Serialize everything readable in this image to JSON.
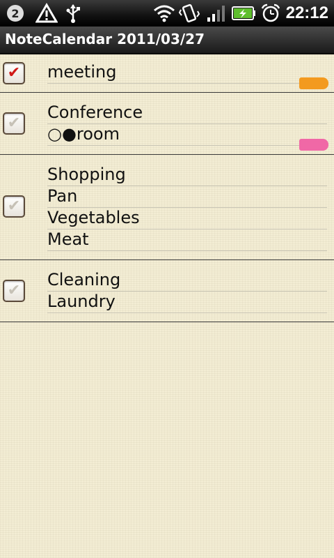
{
  "statusbar": {
    "time": "22:12",
    "icons": [
      "htc-sense-icon",
      "warning-icon",
      "usb-icon",
      "wifi-icon",
      "vibrate-icon",
      "signal-icon",
      "battery-charging-icon",
      "alarm-icon"
    ]
  },
  "title": "NoteCalendar 2011/03/27",
  "notes": [
    {
      "checked": true,
      "lines": [
        "meeting"
      ],
      "tag_color": "#f39a1f"
    },
    {
      "checked": false,
      "lines": [
        "Conference",
        "○●room"
      ],
      "tag_color": "#f068a6"
    },
    {
      "checked": false,
      "lines": [
        "Shopping",
        "Pan",
        "Vegetables",
        "Meat"
      ],
      "tag_color": ""
    },
    {
      "checked": false,
      "lines": [
        "Cleaning",
        "Laundry"
      ],
      "tag_color": ""
    }
  ]
}
